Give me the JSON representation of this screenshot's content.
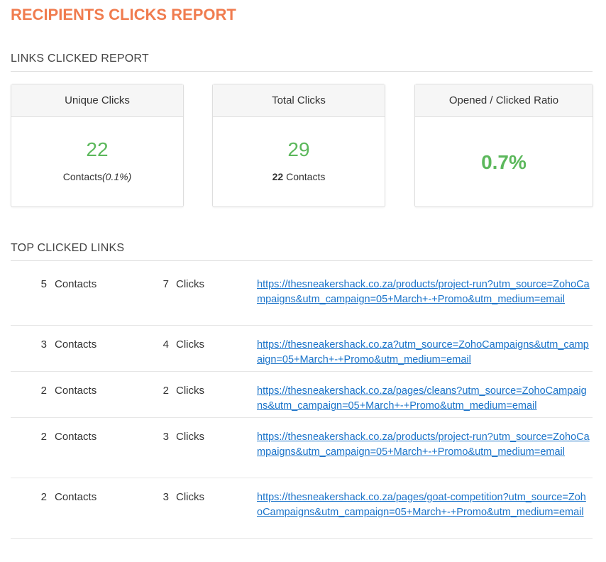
{
  "page": {
    "title": "RECIPIENTS CLICKS REPORT"
  },
  "links_report": {
    "heading": "LINKS CLICKED REPORT",
    "cards": [
      {
        "title": "Unique Clicks",
        "value": "22",
        "sub_text": "Contacts",
        "sub_extra": "(0.1%)"
      },
      {
        "title": "Total Clicks",
        "value": "29",
        "sub_bold": "22",
        "sub_text": " Contacts"
      },
      {
        "title": "Opened / Clicked Ratio",
        "value": "0.7%"
      }
    ]
  },
  "top_links": {
    "heading": "TOP CLICKED LINKS",
    "contacts_label": "Contacts",
    "clicks_label": "Clicks",
    "rows": [
      {
        "contacts": "5",
        "clicks": "7",
        "url": "https://thesneakershack.co.za/products/project-run?utm_source=ZohoCampaigns&utm_campaign=05+March+-+Promo&utm_medium=email"
      },
      {
        "contacts": "3",
        "clicks": "4",
        "url": "https://thesneakershack.co.za?utm_source=ZohoCampaigns&utm_campaign=05+March+-+Promo&utm_medium=email"
      },
      {
        "contacts": "2",
        "clicks": "2",
        "url": "https://thesneakershack.co.za/pages/cleans?utm_source=ZohoCampaigns&utm_campaign=05+March+-+Promo&utm_medium=email"
      },
      {
        "contacts": "2",
        "clicks": "3",
        "url": "https://thesneakershack.co.za/products/project-run?utm_source=ZohoCampaigns&utm_campaign=05+March+-+Promo&utm_medium=email"
      },
      {
        "contacts": "2",
        "clicks": "3",
        "url": "https://thesneakershack.co.za/pages/goat-competition?utm_source=ZohoCampaigns&utm_campaign=05+March+-+Promo&utm_medium=email"
      }
    ]
  },
  "colors": {
    "title": "#f07c4f",
    "value_green": "#5cb85c",
    "link": "#1a73c9"
  }
}
